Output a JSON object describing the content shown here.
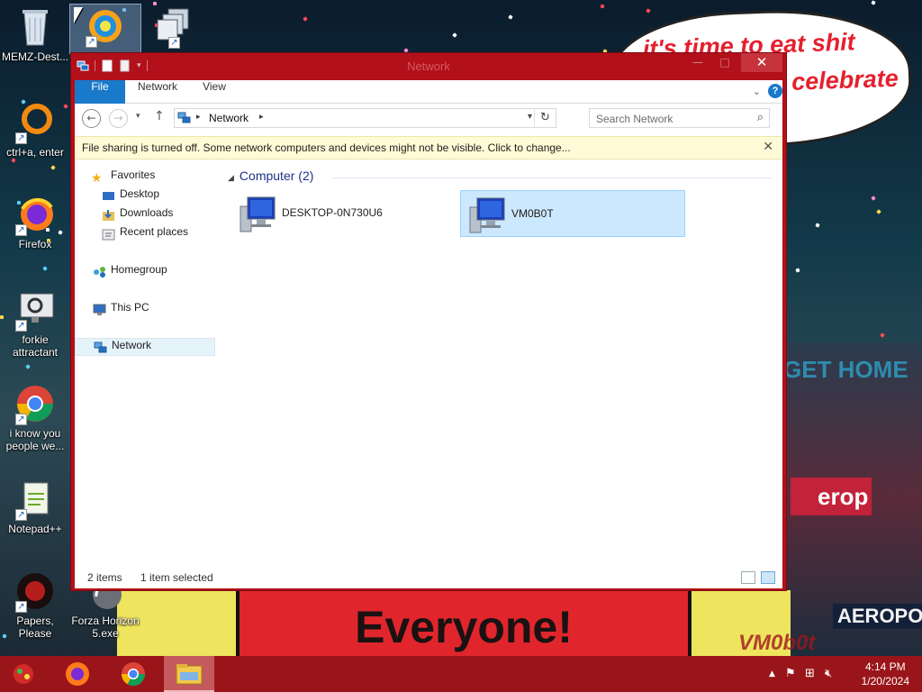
{
  "desktop": {
    "bubble": {
      "line1": "it's time to eat shit",
      "line2": "celebrate"
    },
    "banner": "Everyone!",
    "city_signs": {
      "sign1": "erop",
      "sign2": "AEROPOS",
      "sign3": "GET HOME"
    },
    "watermark": "VM0b0t",
    "icons": [
      {
        "label": "MEMZ-Dest..."
      },
      {
        "label": ""
      },
      {
        "label": ""
      },
      {
        "label": "ctrl+a, enter"
      },
      {
        "label": "Firefox"
      },
      {
        "label": "forkie attractant"
      },
      {
        "label": "i know you people we..."
      },
      {
        "label": "Notepad++"
      },
      {
        "label": "Papers, Please"
      },
      {
        "label": "Forza Horizon 5.exe"
      }
    ]
  },
  "window": {
    "title": "Network",
    "ribbon_tabs": {
      "file": "File",
      "network": "Network",
      "view": "View"
    },
    "help": "?",
    "address": {
      "crumb": "Network"
    },
    "search": {
      "placeholder": "Search Network"
    },
    "infobar": {
      "message": "File sharing is turned off. Some network computers and devices might not be visible. Click to change..."
    },
    "navpane": {
      "favorites": "Favorites",
      "desktop": "Desktop",
      "downloads": "Downloads",
      "recent": "Recent places",
      "homegroup": "Homegroup",
      "thispc": "This PC",
      "network": "Network"
    },
    "group": {
      "header": "Computer (2)"
    },
    "computers": [
      {
        "name": "DESKTOP-0N730U6",
        "selected": false
      },
      {
        "name": "VM0B0T",
        "selected": true
      }
    ],
    "status": {
      "items": "2 items",
      "selected": "1 item selected"
    }
  },
  "taskbar": {
    "clock": {
      "time": "4:14 PM",
      "date": "1/20/2024"
    }
  },
  "colors": {
    "window_frame": "#b2101a",
    "ribbon_file": "#1979ca",
    "taskbar": "#9a1519",
    "selection": "#cce8ff",
    "infobar": "#fffbd6"
  }
}
